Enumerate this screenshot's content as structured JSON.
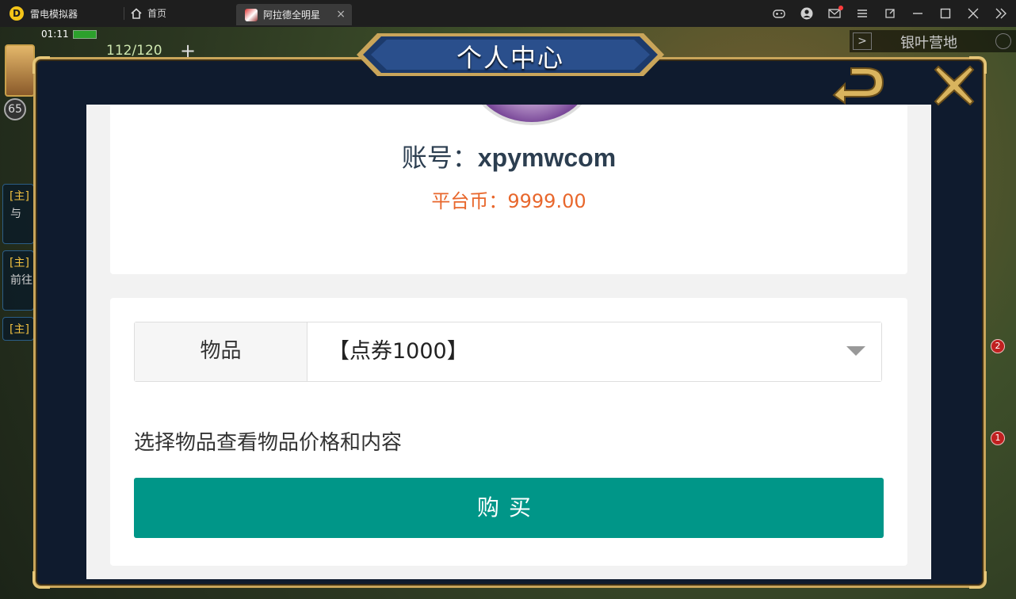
{
  "emulator": {
    "app_name": "雷电模拟器",
    "logo_letter": "D",
    "tabs": [
      {
        "label": "首页",
        "icon": "home-icon"
      },
      {
        "label": "阿拉德全明星",
        "icon": "game-icon",
        "active": true
      }
    ],
    "close_tab_glyph": "×",
    "window_icons": [
      "gamepad-icon",
      "account-icon",
      "mail-icon",
      "menu-icon",
      "popout-icon",
      "minimize-icon",
      "maximize-icon",
      "close-icon",
      "collapse-icon"
    ]
  },
  "game_hud": {
    "time": "01:11",
    "stamina": "112/120",
    "plus": "+",
    "level": "65",
    "location": "银叶营地",
    "side_tasks": [
      {
        "tag": "[主]",
        "text": "与"
      },
      {
        "tag": "[主]",
        "text": "前往"
      },
      {
        "tag": "[主]",
        "text": ""
      }
    ],
    "badges": [
      "2",
      "1"
    ]
  },
  "modal": {
    "title": "个人中心"
  },
  "profile": {
    "account_label": "账号：",
    "account_value": "xpymwcom",
    "coin_label": "平台币：",
    "coin_value": "9999.00"
  },
  "purchase": {
    "item_label": "物品",
    "selected_item": "【点券1000】",
    "hint": "选择物品查看物品价格和内容",
    "buy_label": "购买"
  },
  "colors": {
    "buy_button": "#009688",
    "coin_text": "#e8672c",
    "frame_gold": "#c9a55a",
    "modal_bg": "#0f1b2e"
  }
}
